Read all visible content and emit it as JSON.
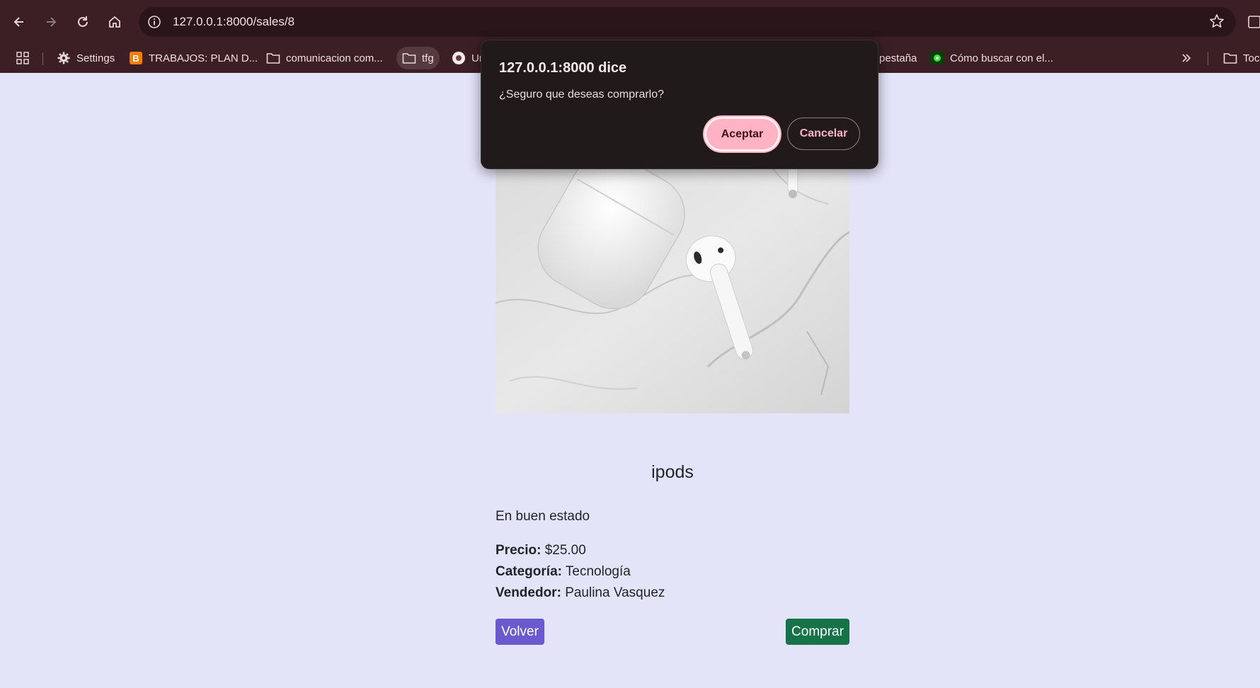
{
  "browser": {
    "url": "127.0.0.1:8000/sales/8",
    "bookmarks": [
      {
        "label": "Settings",
        "icon": "gear-icon"
      },
      {
        "label": "TRABAJOS: PLAN D...",
        "icon": "blogger-icon"
      },
      {
        "label": "comunicacion com...",
        "icon": "folder-icon"
      },
      {
        "label": "tfg",
        "icon": "folder-icon"
      },
      {
        "label": "Ur",
        "icon": "site-icon"
      },
      {
        "label": "pestaña",
        "icon": ""
      },
      {
        "label": "Cómo buscar con el...",
        "icon": "site-icon"
      },
      {
        "label": "Toc",
        "icon": "folder-icon"
      }
    ]
  },
  "dialog": {
    "title": "127.0.0.1:8000 dice",
    "message": "¿Seguro que deseas comprarlo?",
    "ok_label": "Aceptar",
    "cancel_label": "Cancelar"
  },
  "product": {
    "name": "ipods",
    "description": "En buen estado",
    "price_label": "Precio:",
    "price": "$25.00",
    "category_label": "Categoría:",
    "category": "Tecnología",
    "seller_label": "Vendedor:",
    "seller": "Paulina Vasquez",
    "back_label": "Volver",
    "buy_label": "Comprar"
  },
  "colors": {
    "page_bg": "#e4e4f8",
    "chrome_bg": "#3b1f24",
    "back_button": "#6a5acd",
    "buy_button": "#157347",
    "dialog_accent": "#ffb3c3"
  }
}
